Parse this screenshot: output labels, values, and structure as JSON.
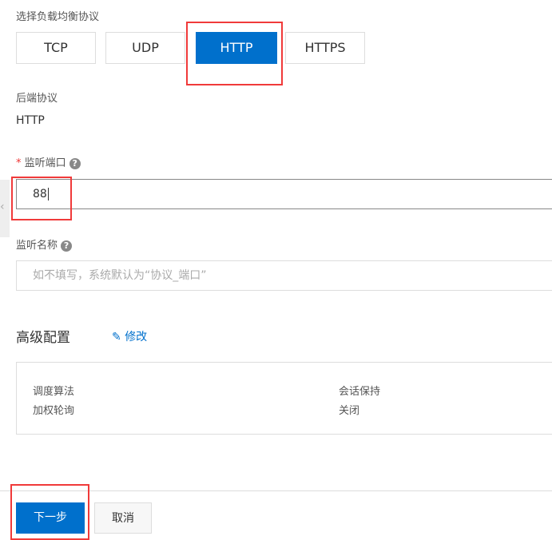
{
  "protocol_label": "选择负载均衡协议",
  "protocols": [
    "TCP",
    "UDP",
    "HTTP",
    "HTTPS"
  ],
  "selected_protocol": "HTTP",
  "backend_label": "后端协议",
  "backend_value": "HTTP",
  "port": {
    "required": "*",
    "label": "监听端口",
    "help": "?",
    "value": "88"
  },
  "name": {
    "label": "监听名称",
    "help": "?",
    "placeholder": "如不填写，系统默认为“协议_端口”"
  },
  "advanced": {
    "title": "高级配置",
    "edit": "修改",
    "items": [
      {
        "label": "调度算法",
        "value": "加权轮询"
      },
      {
        "label": "会话保持",
        "value": "关闭"
      }
    ]
  },
  "footer": {
    "next": "下一步",
    "cancel": "取消"
  }
}
